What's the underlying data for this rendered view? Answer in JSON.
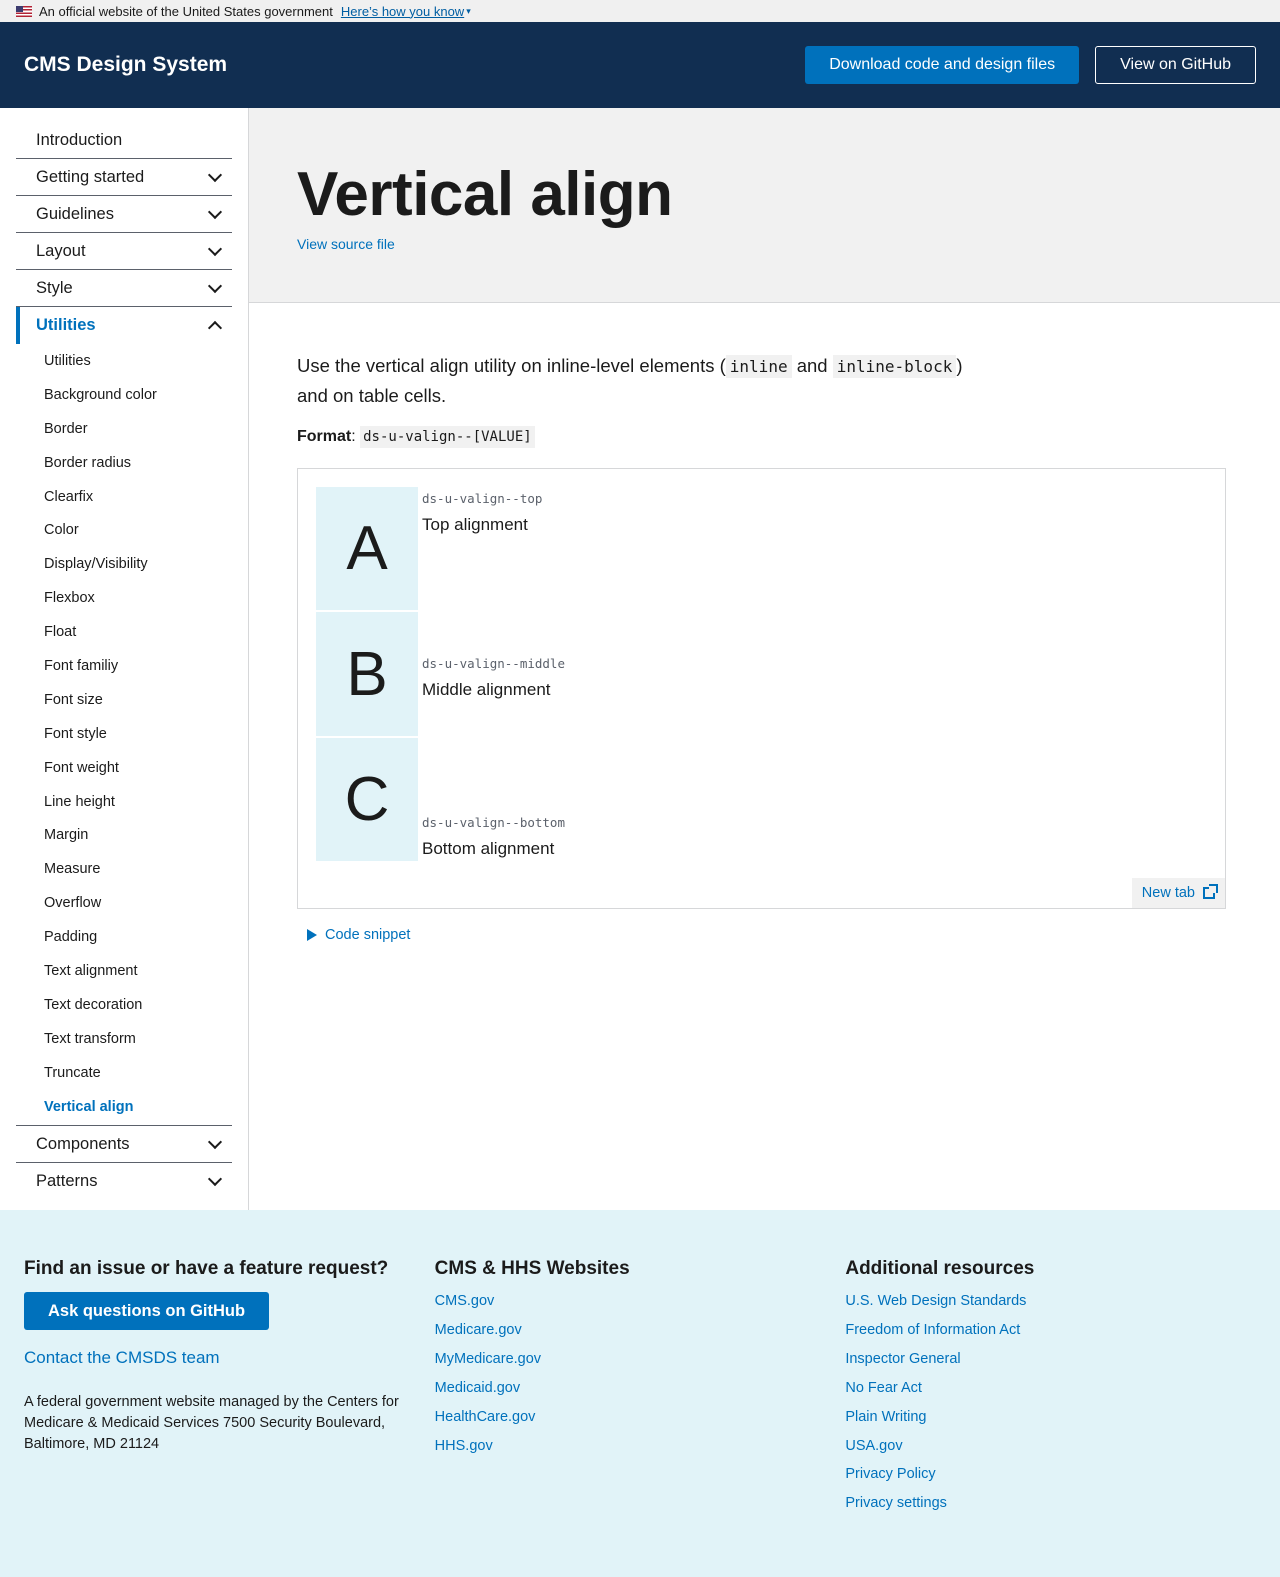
{
  "gov_banner": {
    "text": "An official website of the United States government",
    "link": "Here’s how you know"
  },
  "header": {
    "title": "CMS Design System",
    "download_label": "Download code and design files",
    "github_label": "View on GitHub"
  },
  "sidebar": {
    "top": [
      {
        "label": "Introduction"
      },
      {
        "label": "Getting started"
      },
      {
        "label": "Guidelines"
      },
      {
        "label": "Layout"
      },
      {
        "label": "Style"
      }
    ],
    "active": "Utilities",
    "sub_items": [
      "Utilities",
      "Background color",
      "Border",
      "Border radius",
      "Clearfix",
      "Color",
      "Display/Visibility",
      "Flexbox",
      "Float",
      "Font familiy",
      "Font size",
      "Font style",
      "Font weight",
      "Line height",
      "Margin",
      "Measure",
      "Overflow",
      "Padding",
      "Text alignment",
      "Text decoration",
      "Text transform",
      "Truncate",
      "Vertical align"
    ],
    "bottom": [
      {
        "label": "Components"
      },
      {
        "label": "Patterns"
      }
    ]
  },
  "hero": {
    "title": "Vertical align",
    "source_link": "View source file"
  },
  "content": {
    "lead_pre": "Use the vertical align utility on inline-level elements (",
    "code_inline": "inline",
    "lead_and": "and",
    "code_inline_block": "inline-block",
    "lead_post": ")",
    "lead_line2": "and on table cells.",
    "format_label": "Format",
    "format_code": "ds-u-valign--[VALUE]"
  },
  "example": {
    "rows": [
      {
        "letter": "A",
        "class": "ds-u-valign--top",
        "label": "Top alignment"
      },
      {
        "letter": "B",
        "class": "ds-u-valign--middle",
        "label": "Middle alignment"
      },
      {
        "letter": "C",
        "class": "ds-u-valign--bottom",
        "label": "Bottom alignment"
      }
    ],
    "new_tab": "New tab",
    "code_snippet": "Code snippet"
  },
  "footer": {
    "col1": {
      "heading": "Find an issue or have a feature request?",
      "button": "Ask questions on GitHub",
      "contact": "Contact the CMSDS team",
      "fed_text": "A federal government website managed by the Centers for Medicare & Medicaid Services 7500 Security Boulevard, Baltimore, MD 21124"
    },
    "col2": {
      "heading": "CMS & HHS Websites",
      "links": [
        "CMS.gov",
        "Medicare.gov",
        "MyMedicare.gov",
        "Medicaid.gov",
        "HealthCare.gov",
        "HHS.gov"
      ]
    },
    "col3": {
      "heading": "Additional resources",
      "links": [
        "U.S. Web Design Standards",
        "Freedom of Information Act",
        "Inspector General",
        "No Fear Act",
        "Plain Writing",
        "USA.gov",
        "Privacy Policy",
        "Privacy settings"
      ]
    }
  }
}
